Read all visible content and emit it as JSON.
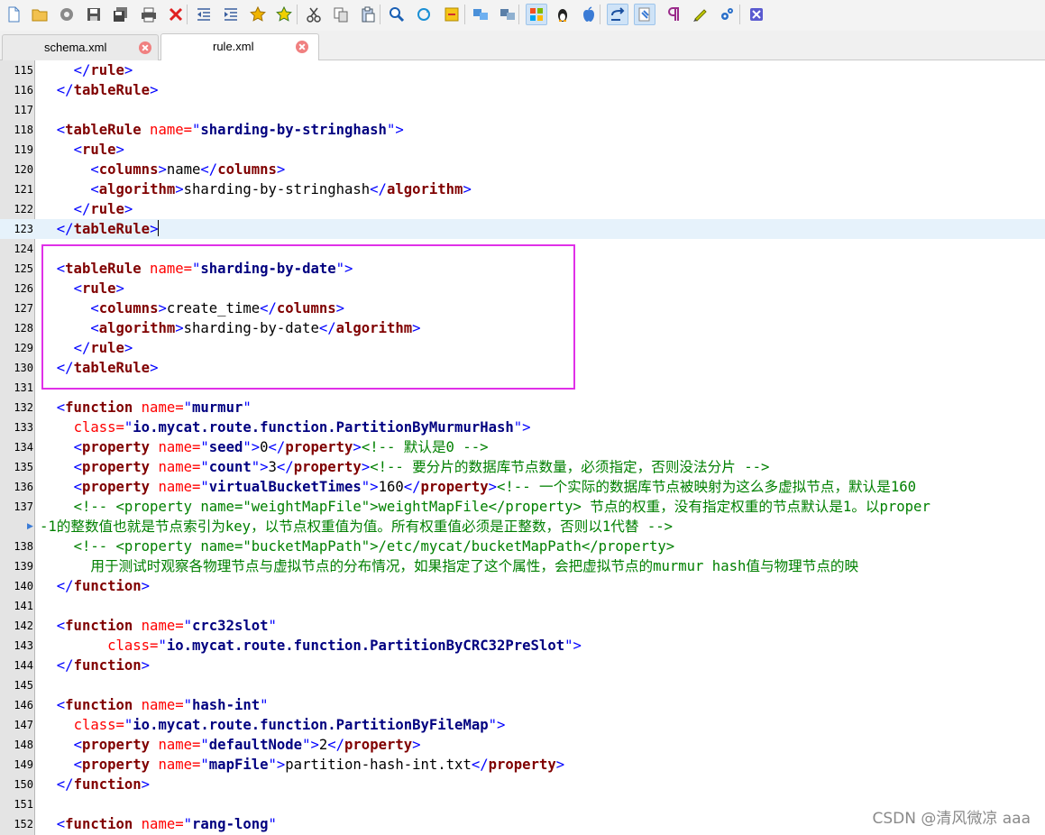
{
  "toolbar": {
    "buttons": [
      {
        "icon": "new-file-icon"
      },
      {
        "icon": "open-folder-icon"
      },
      {
        "icon": "reload-icon"
      },
      {
        "icon": "save-icon"
      },
      {
        "icon": "save-all-icon"
      },
      {
        "icon": "print-icon"
      },
      {
        "icon": "close-icon"
      },
      {
        "icon": "unindent-icon"
      },
      {
        "icon": "indent-icon"
      },
      {
        "icon": "bookmark-star-icon"
      },
      {
        "icon": "bookmark-next-icon"
      },
      {
        "icon": "cut-icon"
      },
      {
        "icon": "copy-icon"
      },
      {
        "icon": "paste-icon"
      },
      {
        "icon": "search-icon"
      },
      {
        "icon": "replace-icon"
      },
      {
        "icon": "note-icon"
      },
      {
        "icon": "compare-icon"
      },
      {
        "icon": "sync-icon"
      },
      {
        "icon": "windows-eol-icon",
        "pressed": true
      },
      {
        "icon": "linux-eol-icon"
      },
      {
        "icon": "mac-eol-icon"
      },
      {
        "icon": "word-wrap-icon",
        "pressed": true
      },
      {
        "icon": "show-whitespace-icon",
        "pressed": true
      },
      {
        "icon": "pilcrow-icon"
      },
      {
        "icon": "highlight-pen-icon"
      },
      {
        "icon": "settings-icon"
      },
      {
        "icon": "exit-icon"
      }
    ]
  },
  "tabs": [
    {
      "label": "schema.xml",
      "active": false
    },
    {
      "label": "rule.xml",
      "active": true
    }
  ],
  "colors": {
    "tag_bracket": "#0000ff",
    "tag_name": "#800000",
    "attribute": "#ff0000",
    "attr_value": "#000080",
    "comment": "#008000",
    "highlight_box": "#e030e8",
    "current_line": "#e6f2fb"
  },
  "editor": {
    "current_line": 123,
    "lines": [
      {
        "n": "115",
        "tokens": [
          [
            "text",
            "    "
          ],
          [
            "tag",
            "</"
          ],
          [
            "tagn",
            "rule"
          ],
          [
            "tag",
            ">"
          ]
        ]
      },
      {
        "n": "116",
        "tokens": [
          [
            "text",
            "  "
          ],
          [
            "tag",
            "</"
          ],
          [
            "tagn",
            "tableRule"
          ],
          [
            "tag",
            ">"
          ]
        ]
      },
      {
        "n": "117",
        "tokens": []
      },
      {
        "n": "118",
        "tokens": [
          [
            "text",
            "  "
          ],
          [
            "tag",
            "<"
          ],
          [
            "tagn",
            "tableRule"
          ],
          [
            "attr",
            " name="
          ],
          [
            "tag",
            "\""
          ],
          [
            "val",
            "sharding-by-stringhash"
          ],
          [
            "tag",
            "\">"
          ]
        ]
      },
      {
        "n": "119",
        "tokens": [
          [
            "text",
            "    "
          ],
          [
            "tag",
            "<"
          ],
          [
            "tagn",
            "rule"
          ],
          [
            "tag",
            ">"
          ]
        ]
      },
      {
        "n": "120",
        "tokens": [
          [
            "text",
            "      "
          ],
          [
            "tag",
            "<"
          ],
          [
            "tagn",
            "columns"
          ],
          [
            "tag",
            ">"
          ],
          [
            "text",
            "name"
          ],
          [
            "tag",
            "</"
          ],
          [
            "tagn",
            "columns"
          ],
          [
            "tag",
            ">"
          ]
        ]
      },
      {
        "n": "121",
        "tokens": [
          [
            "text",
            "      "
          ],
          [
            "tag",
            "<"
          ],
          [
            "tagn",
            "algorithm"
          ],
          [
            "tag",
            ">"
          ],
          [
            "text",
            "sharding-by-stringhash"
          ],
          [
            "tag",
            "</"
          ],
          [
            "tagn",
            "algorithm"
          ],
          [
            "tag",
            ">"
          ]
        ]
      },
      {
        "n": "122",
        "tokens": [
          [
            "text",
            "    "
          ],
          [
            "tag",
            "</"
          ],
          [
            "tagn",
            "rule"
          ],
          [
            "tag",
            ">"
          ]
        ]
      },
      {
        "n": "123",
        "tokens": [
          [
            "text",
            "  "
          ],
          [
            "tag",
            "</"
          ],
          [
            "tagn",
            "tableRule"
          ],
          [
            "tag",
            ">"
          ]
        ],
        "caret": true
      },
      {
        "n": "124",
        "tokens": []
      },
      {
        "n": "125",
        "tokens": [
          [
            "text",
            "  "
          ],
          [
            "tag",
            "<"
          ],
          [
            "tagn",
            "tableRule"
          ],
          [
            "attr",
            " name="
          ],
          [
            "tag",
            "\""
          ],
          [
            "val",
            "sharding-by-date"
          ],
          [
            "tag",
            "\">"
          ]
        ]
      },
      {
        "n": "126",
        "tokens": [
          [
            "text",
            "    "
          ],
          [
            "tag",
            "<"
          ],
          [
            "tagn",
            "rule"
          ],
          [
            "tag",
            ">"
          ]
        ]
      },
      {
        "n": "127",
        "tokens": [
          [
            "text",
            "      "
          ],
          [
            "tag",
            "<"
          ],
          [
            "tagn",
            "columns"
          ],
          [
            "tag",
            ">"
          ],
          [
            "text",
            "create_time"
          ],
          [
            "tag",
            "</"
          ],
          [
            "tagn",
            "columns"
          ],
          [
            "tag",
            ">"
          ]
        ]
      },
      {
        "n": "128",
        "tokens": [
          [
            "text",
            "      "
          ],
          [
            "tag",
            "<"
          ],
          [
            "tagn",
            "algorithm"
          ],
          [
            "tag",
            ">"
          ],
          [
            "text",
            "sharding-by-date"
          ],
          [
            "tag",
            "</"
          ],
          [
            "tagn",
            "algorithm"
          ],
          [
            "tag",
            ">"
          ]
        ]
      },
      {
        "n": "129",
        "tokens": [
          [
            "text",
            "    "
          ],
          [
            "tag",
            "</"
          ],
          [
            "tagn",
            "rule"
          ],
          [
            "tag",
            ">"
          ]
        ]
      },
      {
        "n": "130",
        "tokens": [
          [
            "text",
            "  "
          ],
          [
            "tag",
            "</"
          ],
          [
            "tagn",
            "tableRule"
          ],
          [
            "tag",
            ">"
          ]
        ]
      },
      {
        "n": "131",
        "tokens": []
      },
      {
        "n": "132",
        "tokens": [
          [
            "text",
            "  "
          ],
          [
            "tag",
            "<"
          ],
          [
            "tagn",
            "function"
          ],
          [
            "attr",
            " name="
          ],
          [
            "tag",
            "\""
          ],
          [
            "val",
            "murmur"
          ],
          [
            "tag",
            "\""
          ]
        ]
      },
      {
        "n": "133",
        "tokens": [
          [
            "text",
            "    "
          ],
          [
            "attr",
            "class="
          ],
          [
            "tag",
            "\""
          ],
          [
            "val",
            "io.mycat.route.function.PartitionByMurmurHash"
          ],
          [
            "tag",
            "\">"
          ]
        ]
      },
      {
        "n": "134",
        "tokens": [
          [
            "text",
            "    "
          ],
          [
            "tag",
            "<"
          ],
          [
            "tagn",
            "property"
          ],
          [
            "attr",
            " name="
          ],
          [
            "tag",
            "\""
          ],
          [
            "val",
            "seed"
          ],
          [
            "tag",
            "\">"
          ],
          [
            "text",
            "0"
          ],
          [
            "tag",
            "</"
          ],
          [
            "tagn",
            "property"
          ],
          [
            "tag",
            ">"
          ],
          [
            "comment",
            "<!-- 默认是0 -->"
          ]
        ]
      },
      {
        "n": "135",
        "tokens": [
          [
            "text",
            "    "
          ],
          [
            "tag",
            "<"
          ],
          [
            "tagn",
            "property"
          ],
          [
            "attr",
            " name="
          ],
          [
            "tag",
            "\""
          ],
          [
            "val",
            "count"
          ],
          [
            "tag",
            "\">"
          ],
          [
            "text",
            "3"
          ],
          [
            "tag",
            "</"
          ],
          [
            "tagn",
            "property"
          ],
          [
            "tag",
            ">"
          ],
          [
            "comment",
            "<!-- 要分片的数据库节点数量，必须指定，否则没法分片 -->"
          ]
        ]
      },
      {
        "n": "136",
        "tokens": [
          [
            "text",
            "    "
          ],
          [
            "tag",
            "<"
          ],
          [
            "tagn",
            "property"
          ],
          [
            "attr",
            " name="
          ],
          [
            "tag",
            "\""
          ],
          [
            "val",
            "virtualBucketTimes"
          ],
          [
            "tag",
            "\">"
          ],
          [
            "text",
            "160"
          ],
          [
            "tag",
            "</"
          ],
          [
            "tagn",
            "property"
          ],
          [
            "tag",
            ">"
          ],
          [
            "comment",
            "<!-- 一个实际的数据库节点被映射为这么多虚拟节点，默认是160"
          ]
        ]
      },
      {
        "n": "137",
        "tokens": [
          [
            "text",
            "    "
          ],
          [
            "comment",
            "<!-- <property name=\"weightMapFile\">weightMapFile</property> 节点的权重，没有指定权重的节点默认是1。以proper"
          ]
        ]
      },
      {
        "n": "",
        "wrap": true,
        "tokens": [
          [
            "comment",
            "-1的整数值也就是节点索引为key，以节点权重值为值。所有权重值必须是正整数，否则以1代替 -->"
          ]
        ]
      },
      {
        "n": "138",
        "tokens": [
          [
            "text",
            "    "
          ],
          [
            "comment",
            "<!-- <property name=\"bucketMapPath\">/etc/mycat/bucketMapPath</property>"
          ]
        ]
      },
      {
        "n": "139",
        "tokens": [
          [
            "text",
            "      "
          ],
          [
            "comment",
            "用于测试时观察各物理节点与虚拟节点的分布情况，如果指定了这个属性，会把虚拟节点的murmur hash值与物理节点的映"
          ]
        ]
      },
      {
        "n": "140",
        "tokens": [
          [
            "text",
            "  "
          ],
          [
            "tag",
            "</"
          ],
          [
            "tagn",
            "function"
          ],
          [
            "tag",
            ">"
          ]
        ]
      },
      {
        "n": "141",
        "tokens": []
      },
      {
        "n": "142",
        "tokens": [
          [
            "text",
            "  "
          ],
          [
            "tag",
            "<"
          ],
          [
            "tagn",
            "function"
          ],
          [
            "attr",
            " name="
          ],
          [
            "tag",
            "\""
          ],
          [
            "val",
            "crc32slot"
          ],
          [
            "tag",
            "\""
          ]
        ]
      },
      {
        "n": "143",
        "tokens": [
          [
            "text",
            "        "
          ],
          [
            "attr",
            "class="
          ],
          [
            "tag",
            "\""
          ],
          [
            "val",
            "io.mycat.route.function.PartitionByCRC32PreSlot"
          ],
          [
            "tag",
            "\">"
          ]
        ]
      },
      {
        "n": "144",
        "tokens": [
          [
            "text",
            "  "
          ],
          [
            "tag",
            "</"
          ],
          [
            "tagn",
            "function"
          ],
          [
            "tag",
            ">"
          ]
        ]
      },
      {
        "n": "145",
        "tokens": []
      },
      {
        "n": "146",
        "tokens": [
          [
            "text",
            "  "
          ],
          [
            "tag",
            "<"
          ],
          [
            "tagn",
            "function"
          ],
          [
            "attr",
            " name="
          ],
          [
            "tag",
            "\""
          ],
          [
            "val",
            "hash-int"
          ],
          [
            "tag",
            "\""
          ]
        ]
      },
      {
        "n": "147",
        "tokens": [
          [
            "text",
            "    "
          ],
          [
            "attr",
            "class="
          ],
          [
            "tag",
            "\""
          ],
          [
            "val",
            "io.mycat.route.function.PartitionByFileMap"
          ],
          [
            "tag",
            "\">"
          ]
        ]
      },
      {
        "n": "148",
        "tokens": [
          [
            "text",
            "    "
          ],
          [
            "tag",
            "<"
          ],
          [
            "tagn",
            "property"
          ],
          [
            "attr",
            " name="
          ],
          [
            "tag",
            "\""
          ],
          [
            "val",
            "defaultNode"
          ],
          [
            "tag",
            "\">"
          ],
          [
            "text",
            "2"
          ],
          [
            "tag",
            "</"
          ],
          [
            "tagn",
            "property"
          ],
          [
            "tag",
            ">"
          ]
        ]
      },
      {
        "n": "149",
        "tokens": [
          [
            "text",
            "    "
          ],
          [
            "tag",
            "<"
          ],
          [
            "tagn",
            "property"
          ],
          [
            "attr",
            " name="
          ],
          [
            "tag",
            "\""
          ],
          [
            "val",
            "mapFile"
          ],
          [
            "tag",
            "\">"
          ],
          [
            "text",
            "partition-hash-int.txt"
          ],
          [
            "tag",
            "</"
          ],
          [
            "tagn",
            "property"
          ],
          [
            "tag",
            ">"
          ]
        ]
      },
      {
        "n": "150",
        "tokens": [
          [
            "text",
            "  "
          ],
          [
            "tag",
            "</"
          ],
          [
            "tagn",
            "function"
          ],
          [
            "tag",
            ">"
          ]
        ]
      },
      {
        "n": "151",
        "tokens": []
      },
      {
        "n": "152",
        "tokens": [
          [
            "text",
            "  "
          ],
          [
            "tag",
            "<"
          ],
          [
            "tagn",
            "function"
          ],
          [
            "attr",
            " name="
          ],
          [
            "tag",
            "\""
          ],
          [
            "val",
            "rang-long"
          ],
          [
            "tag",
            "\""
          ]
        ]
      }
    ]
  },
  "watermark": "CSDN @清风微凉 aaa"
}
